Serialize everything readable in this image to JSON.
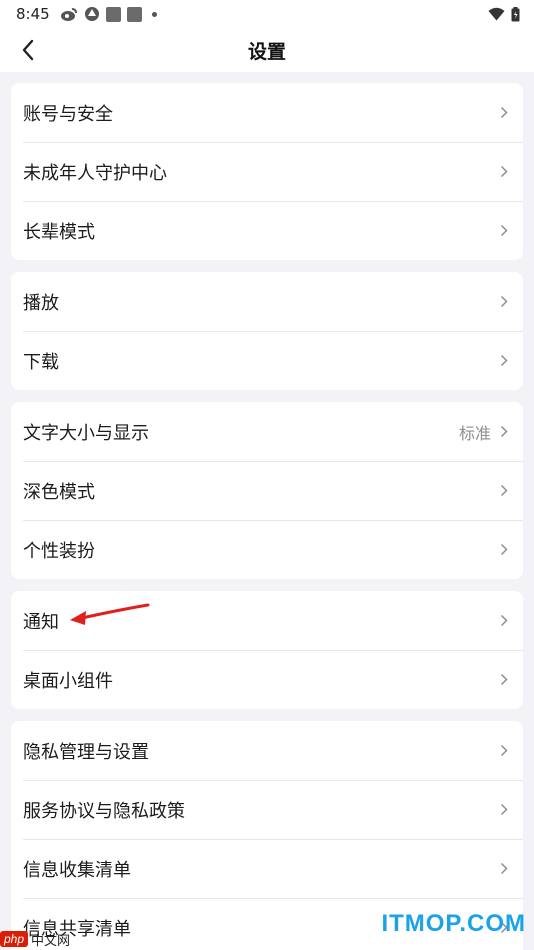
{
  "status_bar": {
    "time": "8:45",
    "icons": [
      "weibo-icon",
      "app-icon",
      "square-icon",
      "square-icon",
      "dot-icon"
    ],
    "right_icons": [
      "wifi-icon",
      "battery-icon"
    ]
  },
  "header": {
    "title": "设置",
    "back_icon": "chevron-left-icon"
  },
  "groups": [
    {
      "items": [
        {
          "label": "账号与安全"
        },
        {
          "label": "未成年人守护中心"
        },
        {
          "label": "长辈模式"
        }
      ]
    },
    {
      "items": [
        {
          "label": "播放"
        },
        {
          "label": "下载"
        }
      ]
    },
    {
      "items": [
        {
          "label": "文字大小与显示",
          "value": "标准"
        },
        {
          "label": "深色模式"
        },
        {
          "label": "个性装扮"
        }
      ]
    },
    {
      "items": [
        {
          "label": "通知"
        },
        {
          "label": "桌面小组件"
        }
      ]
    },
    {
      "items": [
        {
          "label": "隐私管理与设置"
        },
        {
          "label": "服务协议与隐私政策"
        },
        {
          "label": "信息收集清单"
        },
        {
          "label": "信息共享清单"
        }
      ]
    }
  ],
  "watermarks": {
    "left_badge": "php",
    "left_text": "中文网",
    "right": "ITMOP.COM"
  },
  "colors": {
    "background": "#f2f2f7",
    "card": "#ffffff",
    "annotation_arrow": "#e0211b",
    "watermark_right": "#1aa3e8"
  }
}
